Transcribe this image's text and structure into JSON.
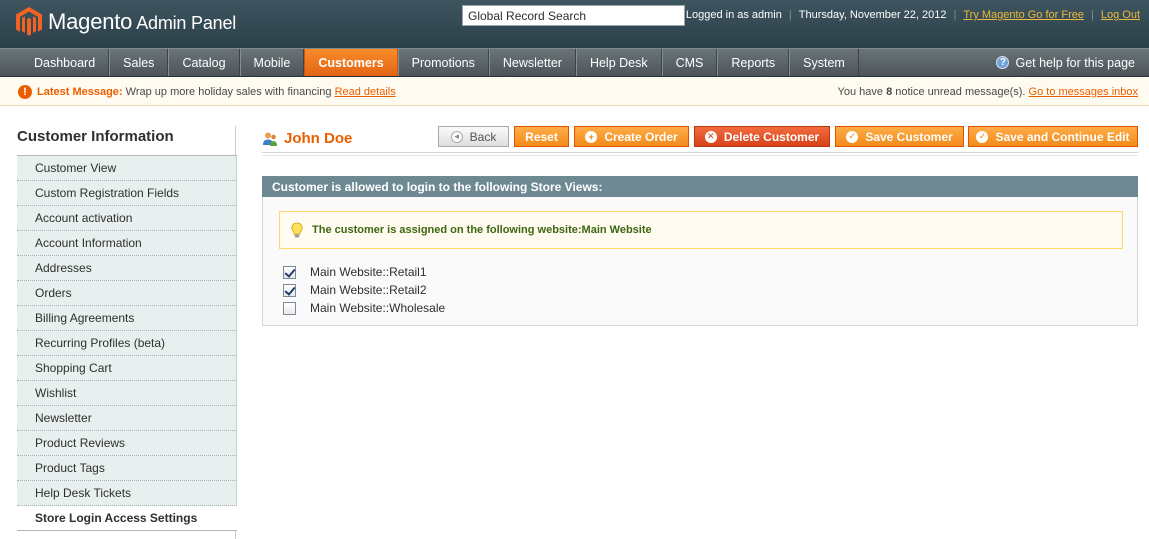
{
  "header": {
    "logo_brand": "Magento",
    "logo_sub": "Admin Panel",
    "search_value": "Global Record Search",
    "logged_in": "Logged in as admin",
    "date": "Thursday, November 22, 2012",
    "try_link": "Try Magento Go for Free",
    "logout": "Log Out"
  },
  "nav": {
    "items": [
      "Dashboard",
      "Sales",
      "Catalog",
      "Mobile",
      "Customers",
      "Promotions",
      "Newsletter",
      "Help Desk",
      "CMS",
      "Reports",
      "System"
    ],
    "active": "Customers",
    "help": "Get help for this page"
  },
  "notice": {
    "label": "Latest Message:",
    "text": "Wrap up more holiday sales with financing",
    "link": "Read details",
    "right_prefix": "You have",
    "right_count": "8",
    "right_suffix": "notice unread message(s).",
    "right_link": "Go to messages inbox"
  },
  "sidebar": {
    "title": "Customer Information",
    "items": [
      "Customer View",
      "Custom Registration Fields",
      "Account activation",
      "Account Information",
      "Addresses",
      "Orders",
      "Billing Agreements",
      "Recurring Profiles (beta)",
      "Shopping Cart",
      "Wishlist",
      "Newsletter",
      "Product Reviews",
      "Product Tags",
      "Help Desk Tickets",
      "Store Login Access Settings"
    ]
  },
  "page": {
    "title": "John Doe",
    "buttons": {
      "back": "Back",
      "reset": "Reset",
      "create_order": "Create Order",
      "delete": "Delete Customer",
      "save": "Save Customer",
      "save_continue": "Save and Continue Edit"
    },
    "fieldset_title": "Customer is allowed to login to the following Store Views:",
    "info": "The customer is assigned on the following website:Main Website",
    "store_views": [
      {
        "label": "Main Website::Retail1",
        "checked": true
      },
      {
        "label": "Main Website::Retail2",
        "checked": true
      },
      {
        "label": "Main Website::Wholesale",
        "checked": false
      }
    ]
  },
  "colors": {
    "accent": "#eb5e00",
    "header_bg": "#2b3f48",
    "fieldset_head": "#6f8992",
    "info_text": "#3d6611"
  }
}
